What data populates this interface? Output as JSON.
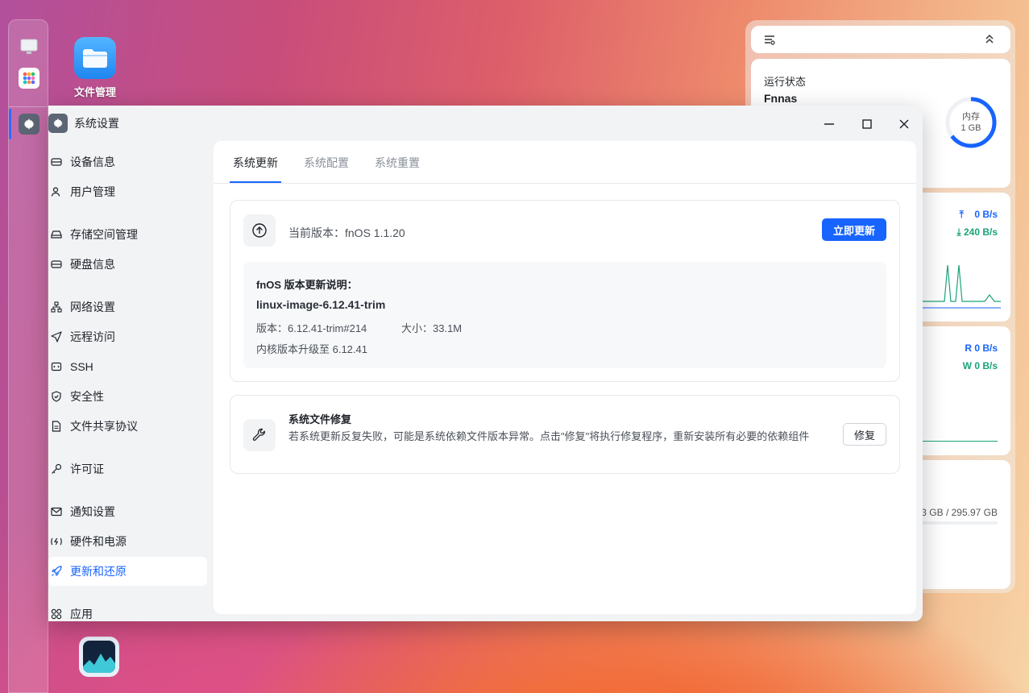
{
  "desktop": {
    "icons": [
      {
        "label": "文件管理",
        "icon": "folder-icon"
      },
      {
        "label": "",
        "icon": "resource-monitor-icon"
      }
    ]
  },
  "dock": {
    "items": [
      "monitor-icon",
      "apps-grid-icon",
      "settings-gear-icon"
    ]
  },
  "widgets": {
    "status": {
      "title": "运行状态",
      "hostname": "Fnnas",
      "memory_label": "内存",
      "memory_value": "1 GB",
      "memory_fraction": 0.65
    },
    "network": {
      "upload": "0 B/s",
      "download": "240 B/s"
    },
    "disk_io": {
      "read": "R 0 B/s",
      "write": "W 0 B/s"
    },
    "storage": {
      "usage": "3 GB / 295.97 GB"
    }
  },
  "window": {
    "title": "系统设置",
    "controls": {
      "minimize": "minimize-icon",
      "maximize": "maximize-icon",
      "close": "close-icon"
    }
  },
  "sidebar": {
    "items": [
      {
        "label": "设备信息",
        "icon": "device-icon"
      },
      {
        "label": "用户管理",
        "icon": "user-icon"
      },
      {
        "label": "存储空间管理",
        "icon": "storage-icon"
      },
      {
        "label": "硬盘信息",
        "icon": "disk-icon"
      },
      {
        "label": "网络设置",
        "icon": "network-icon"
      },
      {
        "label": "远程访问",
        "icon": "send-icon"
      },
      {
        "label": "SSH",
        "icon": "terminal-icon"
      },
      {
        "label": "安全性",
        "icon": "shield-icon"
      },
      {
        "label": "文件共享协议",
        "icon": "document-icon"
      },
      {
        "label": "许可证",
        "icon": "key-icon"
      },
      {
        "label": "通知设置",
        "icon": "mail-icon"
      },
      {
        "label": "硬件和电源",
        "icon": "power-icon"
      },
      {
        "label": "更新和还原",
        "icon": "rocket-icon"
      },
      {
        "label": "应用",
        "icon": "apps-icon"
      }
    ],
    "active_index": 12
  },
  "main": {
    "tabs": [
      {
        "label": "系统更新"
      },
      {
        "label": "系统配置"
      },
      {
        "label": "系统重置"
      }
    ],
    "active_tab": 0,
    "update_card": {
      "current_version": "当前版本：fnOS 1.1.20",
      "update_button": "立即更新",
      "notes_title": "fnOS 版本更新说明：",
      "package_name": "linux-image-6.12.41-trim",
      "version_line": "版本：6.12.41-trim#214",
      "size_line": "大小：33.1M",
      "kernel_line": "内核版本升级至 6.12.41"
    },
    "repair_card": {
      "title": "系统文件修复",
      "description": "若系统更新反复失败，可能是系统依赖文件版本异常。点击\"修复\"将执行修复程序，重新安装所有必要的依赖组件",
      "repair_button": "修复"
    }
  },
  "colors": {
    "accent": "#1764ff",
    "success": "#1aa37a"
  }
}
